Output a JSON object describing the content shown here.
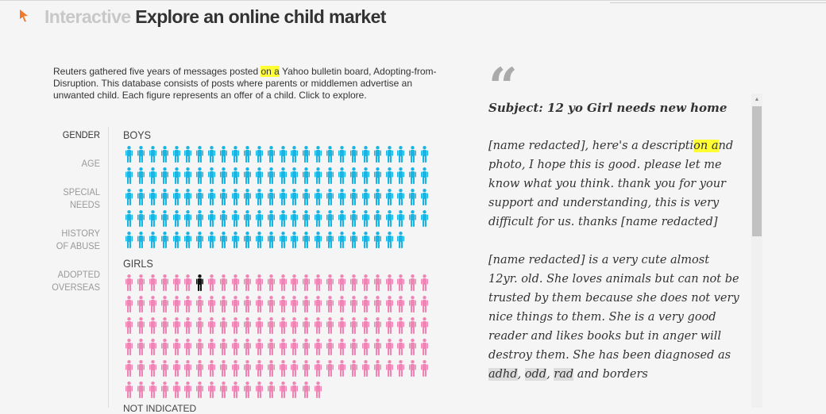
{
  "header": {
    "kicker": "Interactive",
    "title": "Explore an online child market"
  },
  "intro": {
    "before": "Reuters gathered five years of messages posted ",
    "highlight": "on a",
    "after": " Yahoo bulletin board, Adopting-from-Disruption. This database consists of posts where parents or middlemen advertise an unwanted child. Each figure represents an offer of a child. Click to explore."
  },
  "filters": [
    "GENDER",
    "AGE",
    "SPECIAL NEEDS",
    "HISTORY OF ABUSE",
    "ADOPTED OVERSEAS"
  ],
  "groups": {
    "boys": {
      "label": "BOYS",
      "count": 128,
      "color": "#1ab4e2"
    },
    "girls": {
      "label": "GIRLS",
      "count": 147,
      "color": "#ef85b4",
      "selected_index": 6,
      "selected_color": "#111111"
    },
    "next_label": "NOT INDICATED"
  },
  "post": {
    "subject": "Subject: 12 yo Girl needs new home",
    "p1_a": "[name redacted], here's a descripti",
    "p1_hl": "on a",
    "p1_b": "nd photo, I hope this is good. please let me know what you think. thank you for your support and understanding, this is very difficult for us. thanks [name redacted]",
    "p2_a": "[name redacted] is a very cute almost 12yr. old. She loves animals but can not be trusted by them because she does not very nice things to them. She is a very good reader and likes books but in anger will destroy them. She has been diagnosed as ",
    "tag1": "adhd",
    "sep1": ", ",
    "tag2": "odd",
    "sep2": ", ",
    "tag3": "rad",
    "p2_b": " and borders"
  },
  "icons": {
    "cursor": "cursor-arrow-icon",
    "quote": "quote-icon",
    "figure": "person-figure-icon"
  }
}
